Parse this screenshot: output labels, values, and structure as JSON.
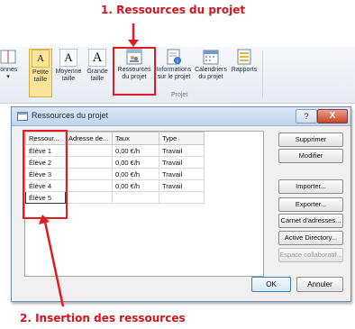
{
  "annotations": {
    "step1": "1. Ressources du projet",
    "step2": "2. Insertion des ressources",
    "color": "#e11b22"
  },
  "ribbon": {
    "items": [
      {
        "label1": "lonnes",
        "label2": "▾",
        "icon": "columns-icon"
      },
      {
        "label1": "Petite",
        "label2": "taille",
        "icon": "text-size-small-icon",
        "glyph": "A",
        "selected": true
      },
      {
        "label1": "Moyenne",
        "label2": "taille",
        "icon": "text-size-medium-icon",
        "glyph": "A"
      },
      {
        "label1": "Grande",
        "label2": "taille",
        "icon": "text-size-large-icon",
        "glyph": "A"
      },
      {
        "label1": "Ressources",
        "label2": "du projet",
        "icon": "project-resources-icon"
      },
      {
        "label1": "Informations",
        "label2": "sur le projet",
        "icon": "project-info-icon"
      },
      {
        "label1": "Calendriers",
        "label2": "du projet",
        "icon": "calendar-icon"
      },
      {
        "label1": "Rapports",
        "label2": "",
        "icon": "reports-icon"
      }
    ],
    "group_name": "Projet"
  },
  "dialog": {
    "title": "Ressources du projet",
    "help_label": "?",
    "close_label": "X",
    "table": {
      "columns": [
        "Ressour...",
        "Adresse de...",
        "Taux",
        "Type"
      ],
      "rows": [
        [
          "Élève 1",
          "",
          "0,00 €/h",
          "Travail"
        ],
        [
          "Élève 2",
          "",
          "0,00 €/h",
          "Travail"
        ],
        [
          "Élève 3",
          "",
          "0,00 €/h",
          "Travail"
        ],
        [
          "Élève 4",
          "",
          "0,00 €/h",
          "Travail"
        ],
        [
          "Élève 5",
          "",
          "",
          ""
        ]
      ]
    },
    "buttons": {
      "delete": "Supprimer",
      "modify": "Modifier",
      "import": "Importer...",
      "export": "Exporter...",
      "address_book": "Carnet d'adresses...",
      "active_directory": "Active Directory...",
      "collab_space": "Espace collaboratif...",
      "ok": "OK",
      "cancel": "Annuler"
    }
  }
}
